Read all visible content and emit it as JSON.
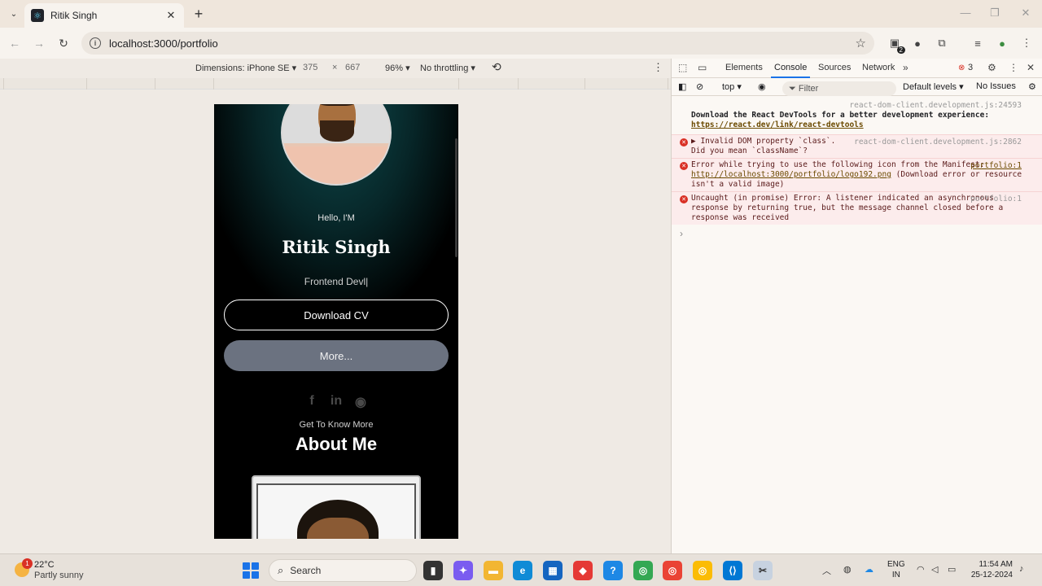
{
  "browser": {
    "tab_title": "Ritik Singh",
    "url": "localhost:3000/portfolio",
    "extension_badge": "2"
  },
  "device_toolbar": {
    "dimensions": "Dimensions: iPhone SE ▾",
    "width": "375",
    "times": "×",
    "height": "667",
    "zoom": "96% ▾",
    "throttling": "No throttling ▾"
  },
  "page": {
    "hello": "Hello, I'M",
    "name": "Ritik Singh",
    "role": "Frontend Devl|",
    "download_cv": "Download CV",
    "more": "More...",
    "get_to_know": "Get To Know More",
    "about_title": "About Me",
    "social_icons": [
      "facebook-icon",
      "linkedin-icon",
      "github-icon"
    ]
  },
  "devtools": {
    "tabs": [
      "Elements",
      "Console",
      "Sources",
      "Network"
    ],
    "active_tab": "Console",
    "error_count": "3",
    "context": "top ▾",
    "filter_placeholder": "Filter",
    "levels": "Default levels ▾",
    "issues": "No Issues",
    "logs": [
      {
        "type": "info",
        "source": "react-dom-client.development.js:24593",
        "text": "Download the React DevTools for a better development experience:",
        "link": "https://react.dev/link/react-devtools"
      },
      {
        "type": "error",
        "source": "react-dom-client.development.js:2862",
        "text": "▶ Invalid DOM property `class`. Did you mean `className`?"
      },
      {
        "type": "error",
        "source": "portfolio:1",
        "text_before": "Error while trying to use the following icon from the Manifest: ",
        "link": "http://localhost:3000/portfolio/logo192.png",
        "text_after": " (Download error or resource isn't a valid image)"
      },
      {
        "type": "error",
        "source": "portfolio:1",
        "text": "Uncaught (in promise) Error: A listener indicated an asynchronous response by returning true, but the message channel closed before a response was received"
      }
    ],
    "prompt": "›"
  },
  "taskbar": {
    "temperature": "22°C",
    "condition": "Partly sunny",
    "weather_badge": "1",
    "search": "Search",
    "lang_line1": "ENG",
    "lang_line2": "IN",
    "time": "11:54 AM",
    "date": "25-12-2024"
  },
  "colors": {
    "accent": "#1a73e8",
    "error": "#d93025",
    "more_button": "#6b7280"
  }
}
